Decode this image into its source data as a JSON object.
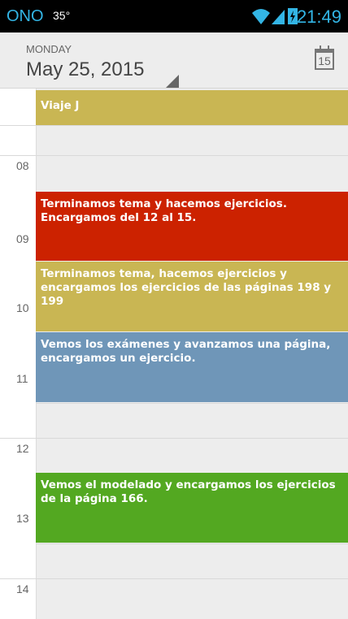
{
  "status_bar": {
    "carrier": "ONO",
    "temperature": "35°",
    "time": "21:49",
    "icons": [
      "wifi-icon",
      "signal-icon",
      "battery-charging-icon"
    ]
  },
  "header": {
    "day_of_week": "MONDAY",
    "date": "May 25, 2015",
    "calendar_icon_day": "15"
  },
  "timeline": {
    "hours": [
      "08",
      "09",
      "10",
      "11",
      "12",
      "13",
      "14"
    ]
  },
  "events": [
    {
      "title": "Viaje J",
      "color": "#c9b653"
    },
    {
      "title": "Terminamos tema y hacemos ejercicios. Encargamos del 12 al 15.",
      "color": "#cc2200"
    },
    {
      "title": "Terminamos tema, hacemos ejercicios y encargamos los ejercicios de las páginas 198 y 199",
      "color": "#c9b653"
    },
    {
      "title": "Vemos los exámenes y avanzamos una página, encargamos un ejercicio.",
      "color": "#6f96b8"
    },
    {
      "title": "Vemos el modelado y encargamos los ejercicios de la página 166.",
      "color": "#53a821"
    }
  ]
}
